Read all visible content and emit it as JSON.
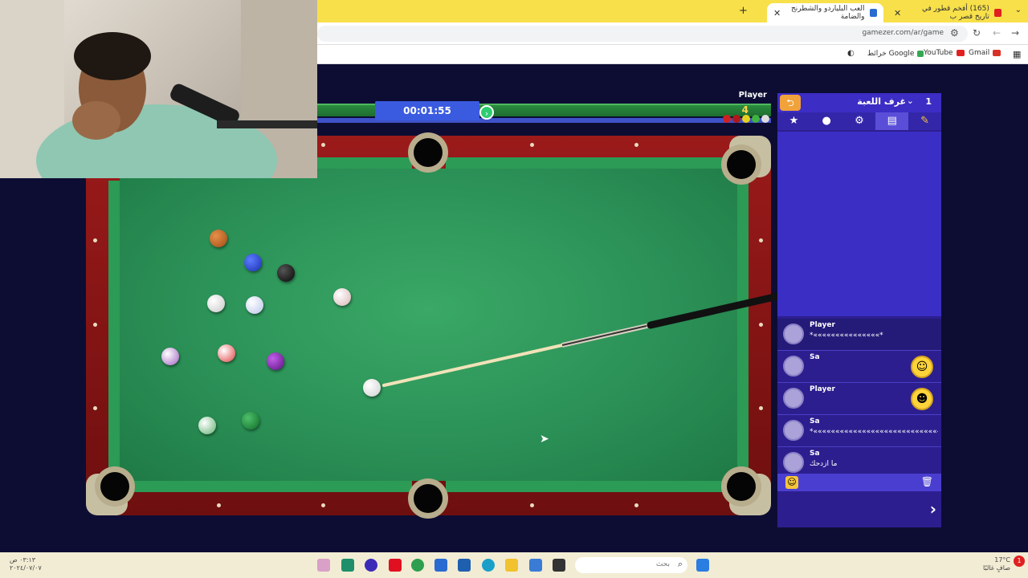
{
  "browser": {
    "tabs": [
      {
        "title": "(165) أفخم قطور في تاريخ قصر ب"
      },
      {
        "title": "العب البلياردو والشطرنج والضامة"
      }
    ],
    "new_tab": "+",
    "url": "gamezer.com/ar/game",
    "bookmarks": [
      "Gmail",
      "YouTube",
      "خرائط Google"
    ]
  },
  "game": {
    "timer": "00:01:55",
    "player_name": "Player",
    "player_score": "4"
  },
  "panel": {
    "title": "غرف اللعبة",
    "count": "1",
    "chat": [
      {
        "name": "Player",
        "text": "*«««««««««««««««*"
      },
      {
        "name": "Sa",
        "text": ""
      },
      {
        "name": "Player",
        "text": ""
      },
      {
        "name": "Sa",
        "text": "*«««««««««««««««««««««««««««««««««««"
      },
      {
        "name": "Sa",
        "text": "ما ازدحك"
      }
    ]
  },
  "taskbar": {
    "time": "٠٣:١٣ ص",
    "date": "٢٠٢٤/٠٧/٠٧",
    "weather_temp": "17°C",
    "weather_desc": "صافٍ غالبًا",
    "search_placeholder": "بحث",
    "notification_count": "1"
  }
}
